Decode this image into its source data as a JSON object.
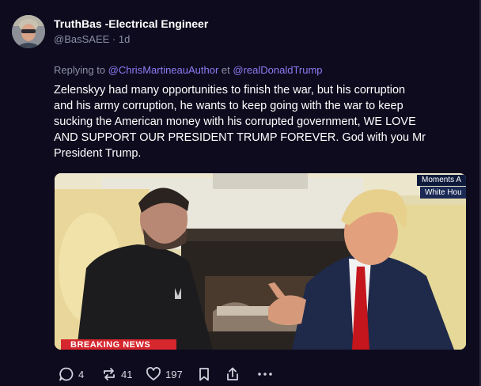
{
  "post": {
    "author": {
      "display_name": "TruthBas -Electrical Engineer",
      "handle": "@BasSAEE",
      "separator": " · ",
      "age": "1d"
    },
    "reply": {
      "prefix": "Replying to ",
      "mention_1": "@ChrisMartineauAuthor",
      "conjunction": " et ",
      "mention_2": "@realDonaldTrump"
    },
    "text_lines": [
      "Zelenskyy had many opportunities to finish the war, but his corruption",
      "and his army corruption, he wants to keep going with the war to keep",
      "sucking the American money with his corrupted government, WE LOVE",
      "AND SUPPORT OUR PRESIDENT TRUMP FOREVER. God with you Mr",
      "President Trump."
    ],
    "media": {
      "overlay_top": "Moments A",
      "overlay_sub": "White Hou",
      "banner": "BREAKING NEWS"
    },
    "actions": {
      "replies": "4",
      "reposts": "41",
      "likes": "197"
    }
  },
  "colors": {
    "background": "#0e0b1e",
    "mention": "#8c7cf5",
    "muted": "#8b8fa6",
    "banner": "#d6262e"
  },
  "icons": [
    "reply-icon",
    "repost-icon",
    "like-icon",
    "bookmark-icon",
    "share-icon",
    "more-icon"
  ]
}
